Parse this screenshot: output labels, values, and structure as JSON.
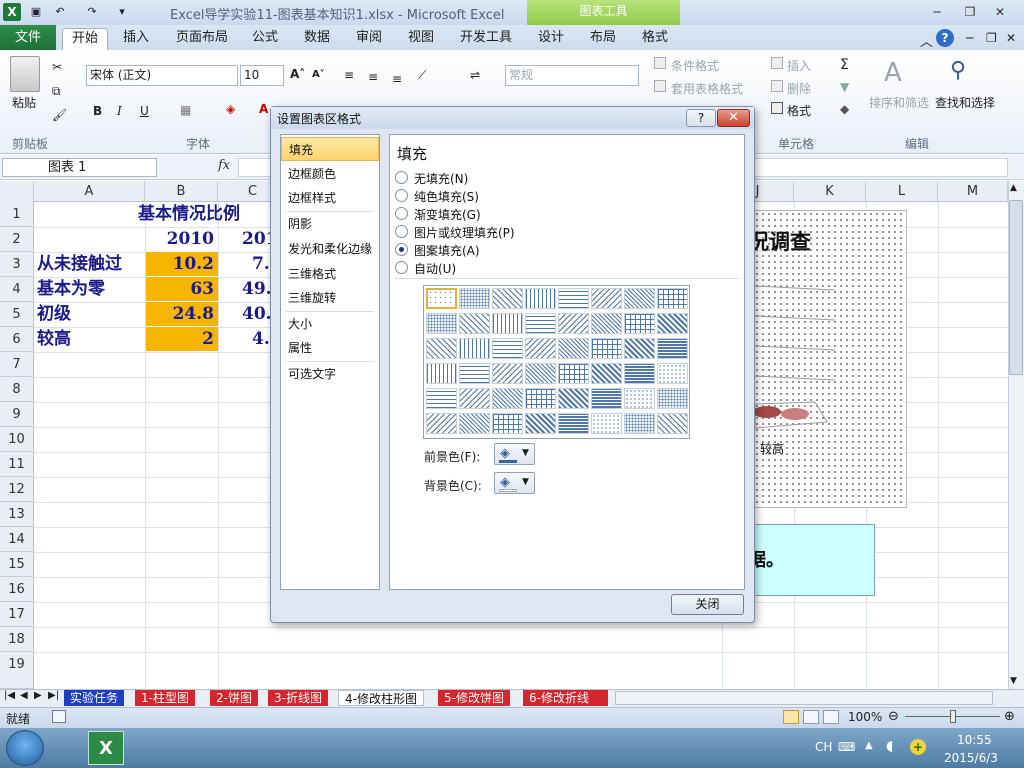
{
  "window": {
    "title": "Excel导学实验11-图表基本知识1.xlsx  -  Microsoft Excel",
    "contextual_tab": "图表工具"
  },
  "ribbon": {
    "file_tab": "文件",
    "tabs": [
      "开始",
      "插入",
      "页面布局",
      "公式",
      "数据",
      "审阅",
      "视图",
      "开发工具",
      "设计",
      "布局",
      "格式"
    ],
    "font_name": "宋体 (正文)",
    "font_size": "10",
    "number_format": "常规",
    "paste_label": "粘贴",
    "cond_format": "条件格式",
    "table_format": "套用表格格式",
    "insert": "插入",
    "delete": "删除",
    "format": "格式",
    "sort_filter": "排序和筛选",
    "find_select": "查找和选择",
    "groups": {
      "clipboard": "剪贴板",
      "font": "字体",
      "cells": "单元格",
      "editing": "编辑"
    }
  },
  "formula_bar": {
    "name_box": "图表 1",
    "fx": "fx"
  },
  "sheet": {
    "columns": [
      "A",
      "B",
      "C",
      "J",
      "K",
      "L",
      "M"
    ],
    "rows": [
      "1",
      "2",
      "3",
      "4",
      "5",
      "6",
      "7",
      "8",
      "9",
      "10",
      "11",
      "12",
      "13",
      "14",
      "15",
      "16",
      "17",
      "18",
      "19"
    ],
    "title": "基本情况比例",
    "header_b": "2010",
    "header_c": "201",
    "labels": [
      "从未接触过",
      "基本为零",
      "初级",
      "较高"
    ],
    "values_b": [
      "10.2",
      "63",
      "24.8",
      "2"
    ],
    "values_c": [
      "7.",
      "49.",
      "40.",
      "4."
    ]
  },
  "chart": {
    "title_fragment": "况调查",
    "category_label": "较高",
    "textbox_fragment": "据。"
  },
  "sheet_tabs": [
    "实验任务",
    "1-柱型图",
    "2-饼图",
    "3-折线图",
    "4-修改柱形图",
    "5-修改饼图",
    "6-修改折线"
  ],
  "active_sheet_index": 4,
  "status": {
    "ready": "就绪",
    "zoom": "100%"
  },
  "taskbar": {
    "lang": "CH",
    "time": "10:55",
    "date": "2015/6/3"
  },
  "dialog": {
    "title": "设置图表区格式",
    "help": "?",
    "close_x": "✕",
    "nav": [
      "填充",
      "边框颜色",
      "边框样式",
      "阴影",
      "发光和柔化边缘",
      "三维格式",
      "三维旋转",
      "大小",
      "属性",
      "可选文字"
    ],
    "selected_nav": 0,
    "heading": "填充",
    "fill_options": [
      "无填充(N)",
      "纯色填充(S)",
      "渐变填充(G)",
      "图片或纹理填充(P)",
      "图案填充(A)",
      "自动(U)"
    ],
    "selected_fill": 4,
    "foreground_label": "前景色(F):",
    "background_label": "背景色(C):",
    "close_button": "关闭"
  }
}
